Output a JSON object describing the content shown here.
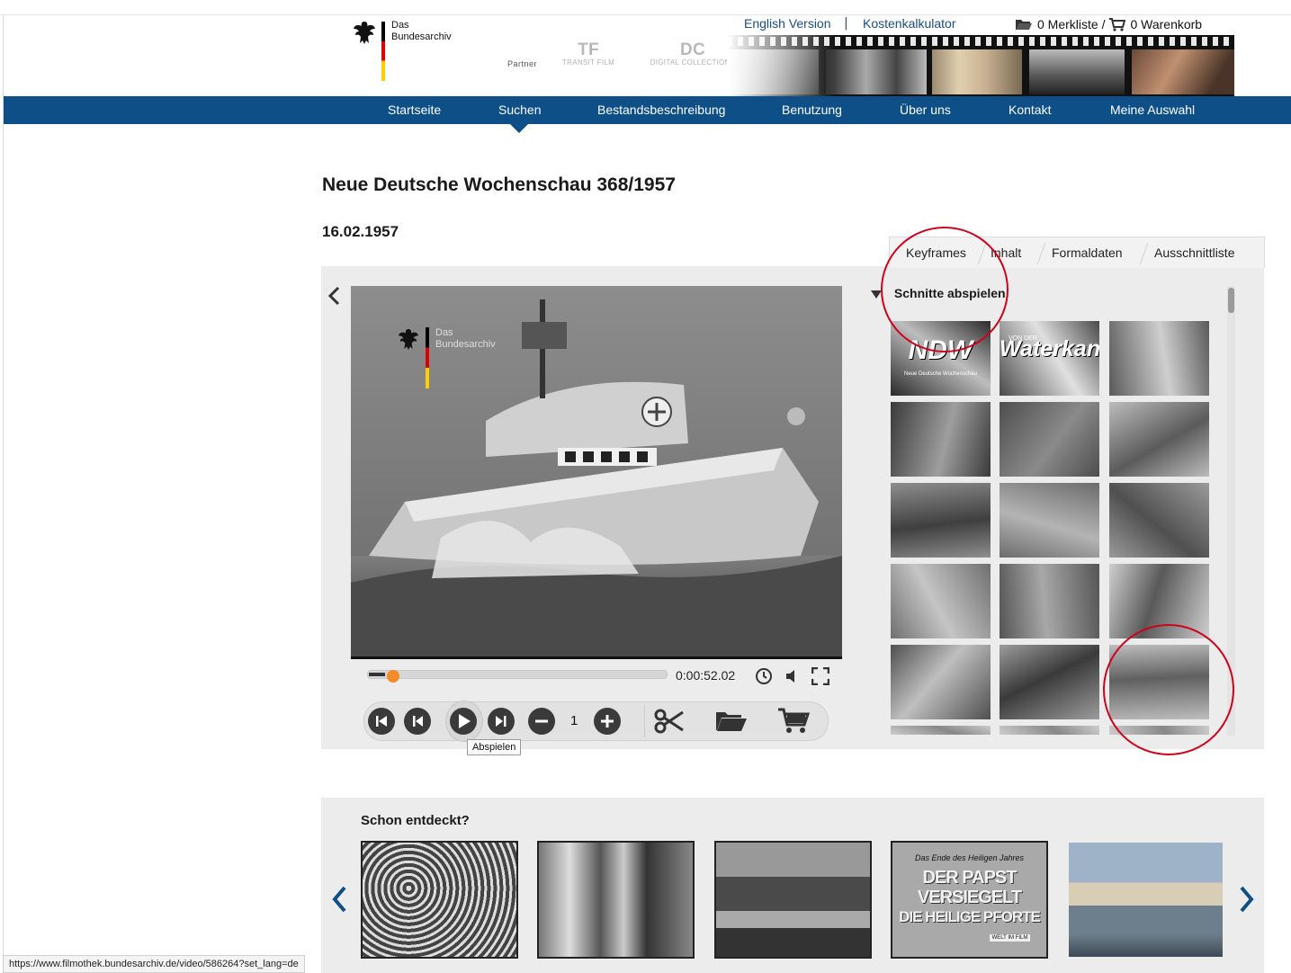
{
  "header": {
    "logo": {
      "line1": "Das",
      "line2": "Bundesarchiv"
    },
    "partner_label": "Partner",
    "partners": [
      {
        "mark": "TF",
        "name": "TRANSIT FILM"
      },
      {
        "mark": "DC",
        "name": "DIGITAL COLLECTIONS"
      }
    ],
    "links": {
      "english": "English Version",
      "separator": "|",
      "calculator": "Kostenkalkulator"
    },
    "merkliste": "0 Merkliste /",
    "warenkorb": "0 Warenkorb"
  },
  "nav": {
    "items": [
      "Startseite",
      "Suchen",
      "Bestandsbeschreibung",
      "Benutzung",
      "Über uns",
      "Kontakt",
      "Meine Auswahl"
    ],
    "active": "Suchen"
  },
  "page": {
    "title": "Neue Deutsche Wochenschau 368/1957",
    "date": "16.02.1957"
  },
  "tabs": {
    "items": [
      "Keyframes",
      "Inhalt",
      "Formaldaten",
      "Ausschnittliste"
    ],
    "active": "Keyframes"
  },
  "player": {
    "watermark": {
      "line1": "Das",
      "line2": "Bundesarchiv"
    },
    "time": "0:00:52.02",
    "speed": "1",
    "progress_percent": 7,
    "tooltip": "Abspielen"
  },
  "keyframes": {
    "heading": "Schnitte abspielen",
    "thumb_texts": [
      {
        "big": "NDW",
        "small": "Neue Deutsche Wochenschau"
      },
      {
        "big": "Waterkant",
        "small": "VON DER"
      }
    ]
  },
  "discover": {
    "title": "Schon entdeckt?",
    "papst_thumb": {
      "top": "Das Ende des Heiligen Jahres",
      "line1": "DER PAPST",
      "line2": "VERSIEGELT",
      "line3": "DIE HEILIGE PFORTE",
      "badge": "WELT IM FILM"
    }
  },
  "statusbar": {
    "url": "https://www.filmothek.bundesarchiv.de/video/586264?set_lang=de"
  },
  "colors": {
    "nav": "#0d4f86",
    "link": "#1a4d80",
    "annotation": "#d0021b",
    "progress": "#f28c28"
  }
}
